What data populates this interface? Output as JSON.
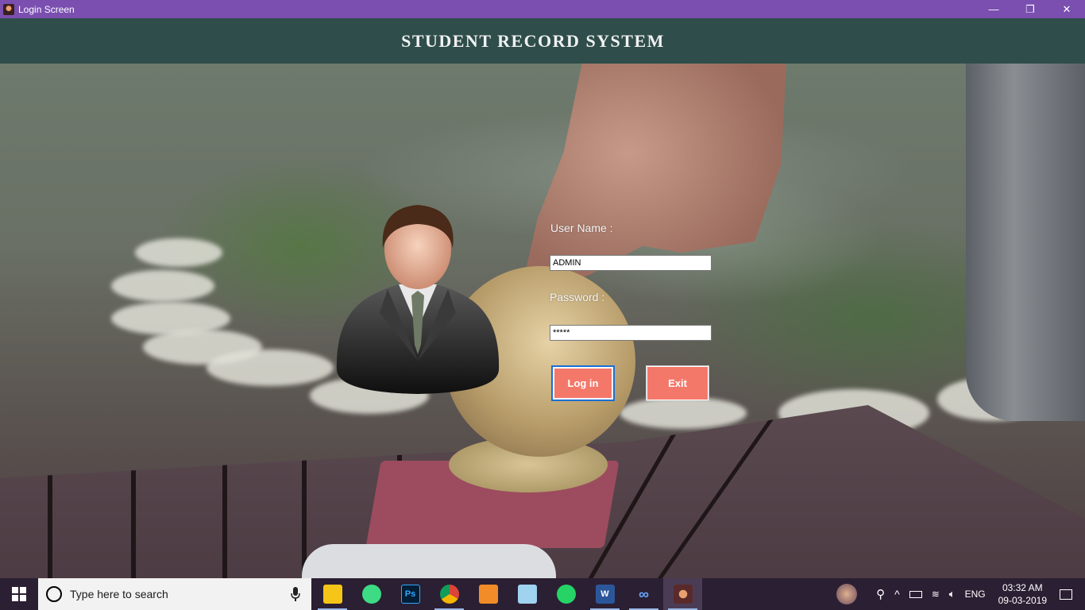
{
  "window": {
    "title": "Login Screen",
    "controls": {
      "minimize": "—",
      "restore": "❐",
      "close": "✕"
    }
  },
  "header": {
    "title": "STUDENT RECORD SYSTEM"
  },
  "form": {
    "username_label": "User Name :",
    "username_value": "ADMIN",
    "password_label": "Password :",
    "password_value": "*****",
    "login_button": "Log in",
    "exit_button": "Exit"
  },
  "colors": {
    "titlebar": "#7a4fb0",
    "header": "#2e4d4b",
    "button": "#f4786a",
    "taskbar": "#2b1f33"
  },
  "taskbar": {
    "search_placeholder": "Type here to search",
    "apps": [
      {
        "name": "file-explorer-icon",
        "label": ""
      },
      {
        "name": "android-studio-icon",
        "label": ""
      },
      {
        "name": "photoshop-icon",
        "label": "Ps"
      },
      {
        "name": "chrome-icon",
        "label": ""
      },
      {
        "name": "media-player-icon",
        "label": ""
      },
      {
        "name": "3d-box-icon",
        "label": ""
      },
      {
        "name": "whatsapp-icon",
        "label": ""
      },
      {
        "name": "word-icon",
        "label": "W"
      },
      {
        "name": "infinity-app-icon",
        "label": ""
      },
      {
        "name": "login-app-icon",
        "label": ""
      }
    ],
    "tray": {
      "language": "ENG",
      "time": "03:32 AM",
      "date": "09-03-2019"
    }
  }
}
